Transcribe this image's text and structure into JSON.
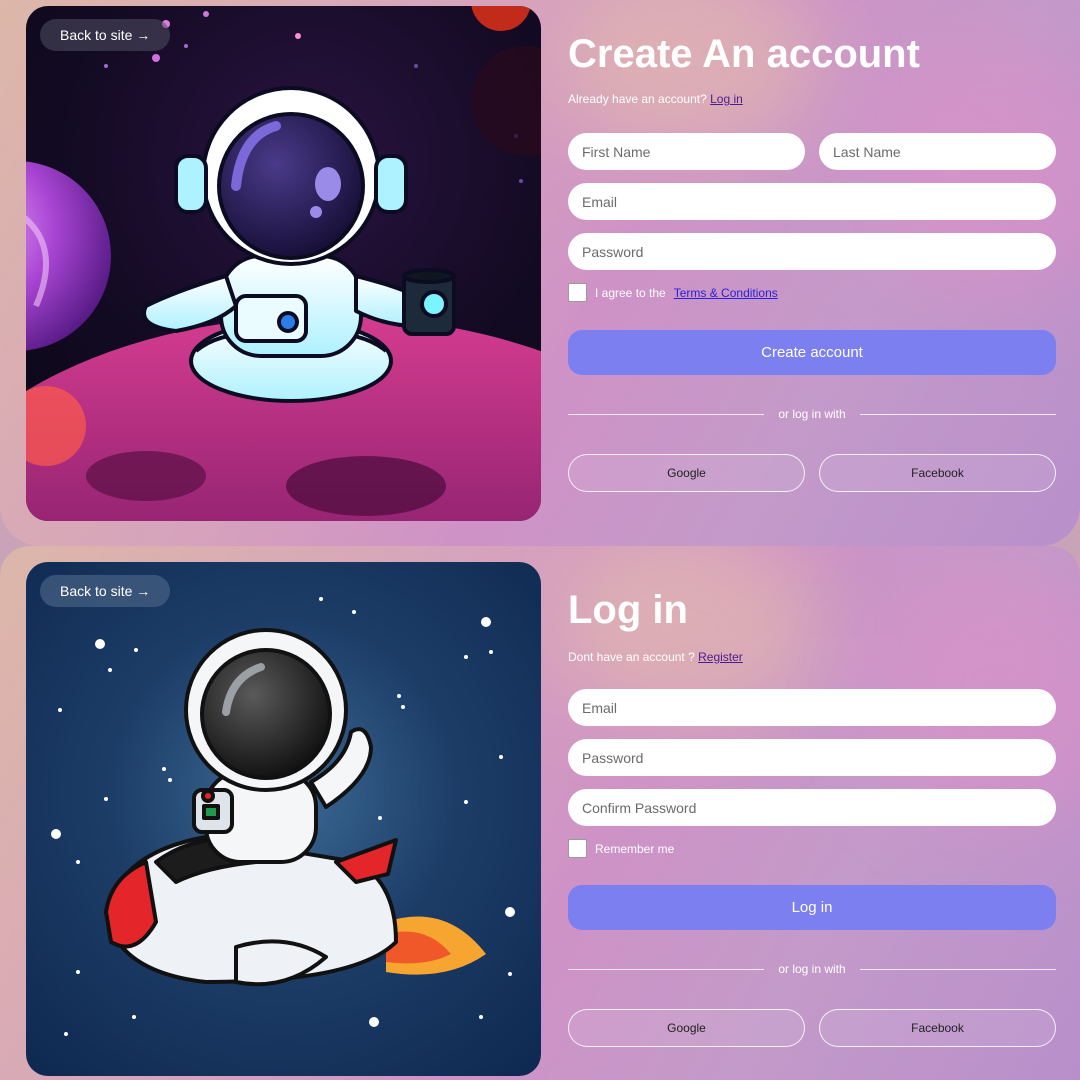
{
  "register": {
    "back_label": "Back to site →",
    "title": "Create An account",
    "subtitle_text": "Already have an account?",
    "subtitle_link": "Log in",
    "first_name_placeholder": "First Name",
    "last_name_placeholder": "Last Name",
    "email_placeholder": "Email",
    "password_placeholder": "Password",
    "agree_text": "I agree to the",
    "terms_link": "Terms & Conditions",
    "submit_label": "Create account",
    "divider_text": "or log in with",
    "google_label": "Google",
    "facebook_label": "Facebook"
  },
  "login": {
    "back_label": "Back to site →",
    "title": "Log in",
    "subtitle_text": "Dont have an account ?",
    "subtitle_link": "Register",
    "email_placeholder": "Email",
    "password_placeholder": "Password",
    "confirm_placeholder": "Confirm Password",
    "remember_label": "Remember me",
    "submit_label": "Log in",
    "divider_text": "or log in with",
    "google_label": "Google",
    "facebook_label": "Facebook"
  },
  "colors": {
    "accent_button": "#7b7ff0",
    "link_purple": "#4a1d8f",
    "terms_link": "#2a22d6"
  },
  "illustrations": {
    "top": "astronaut-meditating-with-coffee-icon",
    "bottom": "astronaut-riding-rocket-icon"
  }
}
